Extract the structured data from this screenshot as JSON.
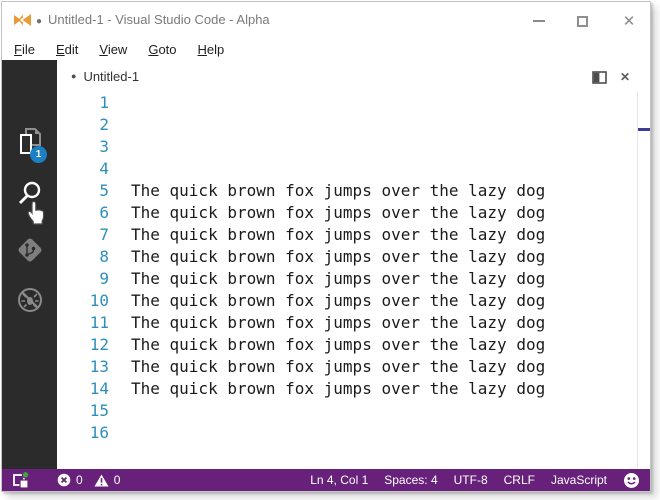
{
  "title_bar": {
    "dirty_dot": "●",
    "title": "Untitled-1 - Visual Studio Code - Alpha",
    "close_glyph": "✕"
  },
  "menu_bar": {
    "items": [
      {
        "head": "F",
        "rest": "ile"
      },
      {
        "head": "E",
        "rest": "dit"
      },
      {
        "head": "V",
        "rest": "iew"
      },
      {
        "head": "G",
        "rest": "oto"
      },
      {
        "head": "H",
        "rest": "elp"
      }
    ]
  },
  "activity_bar": {
    "explorer_badge": "1",
    "items": [
      "explorer",
      "search",
      "source-control",
      "debug"
    ]
  },
  "tab_bar": {
    "dirty_dot": "●",
    "label": "Untitled-1",
    "close_glyph": "✕"
  },
  "editor": {
    "lines": [
      {
        "n": "1",
        "text": ""
      },
      {
        "n": "2",
        "text": ""
      },
      {
        "n": "3",
        "text": ""
      },
      {
        "n": "4",
        "text": ""
      },
      {
        "n": "5",
        "text": "The quick brown fox jumps over the lazy dog"
      },
      {
        "n": "6",
        "text": "The quick brown fox jumps over the lazy dog"
      },
      {
        "n": "7",
        "text": "The quick brown fox jumps over the lazy dog"
      },
      {
        "n": "8",
        "text": "The quick brown fox jumps over the lazy dog"
      },
      {
        "n": "9",
        "text": "The quick brown fox jumps over the lazy dog"
      },
      {
        "n": "10",
        "text": "The quick brown fox jumps over the lazy dog"
      },
      {
        "n": "11",
        "text": "The quick brown fox jumps over the lazy dog"
      },
      {
        "n": "12",
        "text": "The quick brown fox jumps over the lazy dog"
      },
      {
        "n": "13",
        "text": "The quick brown fox jumps over the lazy dog"
      },
      {
        "n": "14",
        "text": "The quick brown fox jumps over the lazy dog"
      },
      {
        "n": "15",
        "text": ""
      },
      {
        "n": "16",
        "text": ""
      }
    ]
  },
  "status_bar": {
    "error_count": "0",
    "warning_count": "0",
    "cursor_position": "Ln 4, Col 1",
    "indentation": "Spaces: 4",
    "encoding": "UTF-8",
    "eol": "CRLF",
    "language": "JavaScript"
  },
  "icons": {
    "app": "vs-logo-bowtie",
    "activity": [
      "files-pages",
      "magnifier",
      "git-diamond",
      "no-bug"
    ],
    "pointer": "hand-pointer",
    "tab_actions": [
      "split-editor",
      "close"
    ],
    "status": [
      "update-available",
      "error-circle",
      "warning-triangle",
      "feedback-smiley"
    ]
  },
  "colors": {
    "status_bar": "#68217A",
    "activity_bar": "#2B2B2B",
    "badge_blue": "#1B80C4",
    "line_number_blue": "#2E8FBE",
    "logo_orange": "#E59C38",
    "overview_cursor_marker": "#3B3E93",
    "badge_green": "#3DA73D"
  }
}
